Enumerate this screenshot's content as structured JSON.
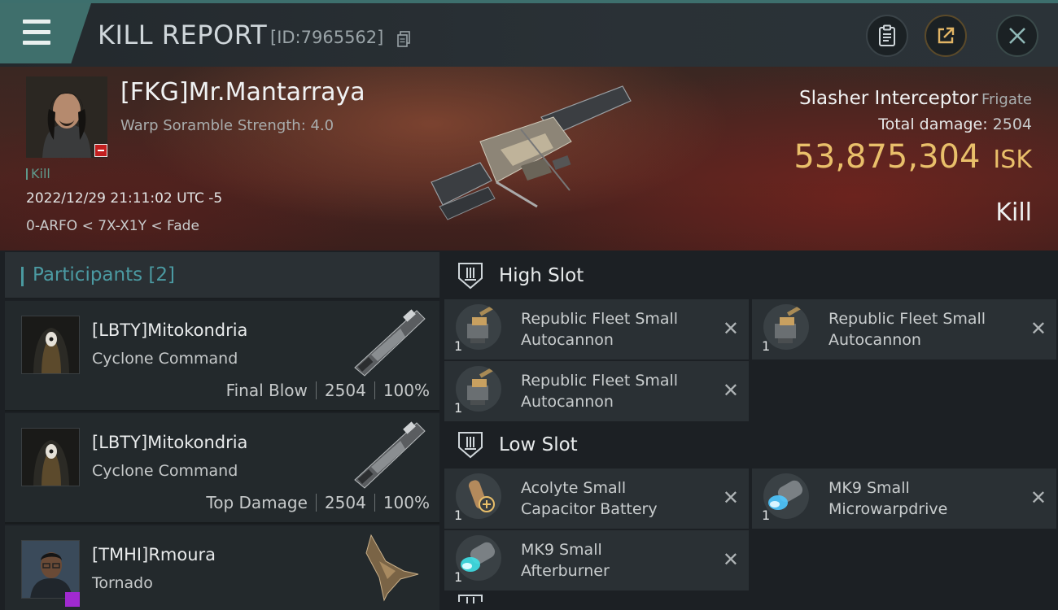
{
  "header": {
    "title": "KILL REPORT",
    "report_id": "[ID:7965562]"
  },
  "victim": {
    "name": "[FKG]Mr.Mantarraya",
    "scramble": "Warp Soramble Strength: 4.0",
    "kill_tag": "Kill",
    "datetime": "2022/12/29 21:11:02 UTC -5",
    "location": "0-ARFO < 7X-X1Y < Fade",
    "ship_name": "Slasher Interceptor",
    "ship_class": "Frigate",
    "total_damage_label": "Total damage:",
    "total_damage": "2504",
    "isk_value": "53,875,304",
    "isk_unit": "ISK",
    "result": "Kill"
  },
  "participants": {
    "header_label": "Participants",
    "count": "[2]",
    "items": [
      {
        "name": "[LBTY]Mitokondria",
        "ship": "Cyclone Command",
        "role": "Final Blow",
        "damage": "2504",
        "percent": "100%"
      },
      {
        "name": "[LBTY]Mitokondria",
        "ship": "Cyclone Command",
        "role": "Top Damage",
        "damage": "2504",
        "percent": "100%"
      },
      {
        "name": "[TMHI]Rmoura",
        "ship": "Tornado",
        "role": "",
        "damage": "",
        "percent": ""
      }
    ]
  },
  "slots": {
    "high": {
      "title": "High Slot",
      "modules": [
        {
          "qty": "1",
          "line1": "Republic Fleet Small",
          "line2": "Autocannon",
          "icon": "autocannon-icon"
        },
        {
          "qty": "1",
          "line1": "Republic Fleet Small",
          "line2": "Autocannon",
          "icon": "autocannon-icon"
        },
        {
          "qty": "1",
          "line1": "Republic Fleet Small",
          "line2": "Autocannon",
          "icon": "autocannon-icon"
        }
      ]
    },
    "low": {
      "title": "Low Slot",
      "modules": [
        {
          "qty": "1",
          "line1": "Acolyte Small",
          "line2": "Capacitor Battery",
          "icon": "capacitor-battery-icon"
        },
        {
          "qty": "1",
          "line1": "MK9 Small",
          "line2": "Microwarpdrive",
          "icon": "microwarpdrive-icon"
        },
        {
          "qty": "1",
          "line1": "MK9 Small",
          "line2": "Afterburner",
          "icon": "afterburner-icon"
        }
      ]
    },
    "close_glyph": "✕"
  },
  "colors": {
    "accent_teal": "#3f6f6c",
    "isk_gold": "#e9bf6a",
    "participants_blue": "#4b9aa2"
  }
}
